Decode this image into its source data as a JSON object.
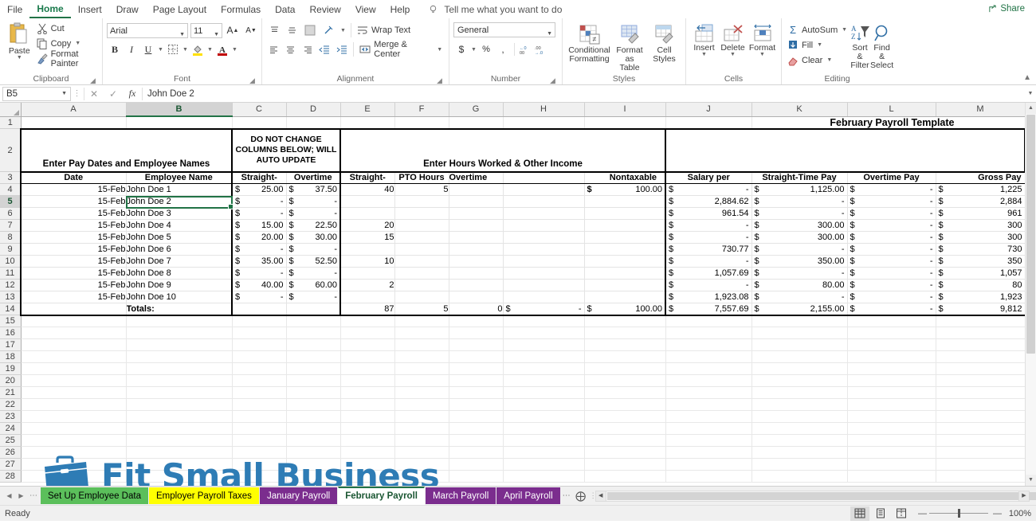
{
  "ribbon": {
    "tabs": [
      {
        "label": "File"
      },
      {
        "label": "Home"
      },
      {
        "label": "Insert"
      },
      {
        "label": "Draw"
      },
      {
        "label": "Page Layout"
      },
      {
        "label": "Formulas"
      },
      {
        "label": "Data"
      },
      {
        "label": "Review"
      },
      {
        "label": "View"
      },
      {
        "label": "Help"
      }
    ],
    "active_tab": "Home",
    "tellme": "Tell me what you want to do",
    "share": "Share",
    "groups": {
      "clipboard": {
        "label": "Clipboard",
        "paste": "Paste",
        "cut": "Cut",
        "copy": "Copy",
        "format_painter": "Format Painter"
      },
      "font": {
        "label": "Font",
        "font_name": "Arial",
        "font_size": "11",
        "bold": "B",
        "italic": "I",
        "underline": "U",
        "grow": "A",
        "shrink": "A"
      },
      "alignment": {
        "label": "Alignment",
        "wrap_text": "Wrap Text",
        "merge_center": "Merge & Center"
      },
      "number": {
        "label": "Number",
        "format": "General",
        "currency": "$",
        "percent": "%",
        "comma": ","
      },
      "styles": {
        "label": "Styles",
        "conditional_formatting": "Conditional\nFormatting",
        "cf_l1": "Conditional",
        "cf_l2": "Formatting",
        "fat_l1": "Format as",
        "fat_l2": "Table",
        "cs_l1": "Cell",
        "cs_l2": "Styles"
      },
      "cells": {
        "label": "Cells",
        "insert": "Insert",
        "delete": "Delete",
        "format": "Format"
      },
      "editing": {
        "label": "Editing",
        "autosum": "AutoSum",
        "fill": "Fill",
        "clear": "Clear",
        "sort_l1": "Sort &",
        "sort_l2": "Filter",
        "find_l1": "Find &",
        "find_l2": "Select"
      }
    }
  },
  "formula_bar": {
    "name_box": "B5",
    "cancel_icon": "✕",
    "enter_icon": "✓",
    "fx_icon": "fx",
    "value": "John Doe 2"
  },
  "sheet": {
    "columns": [
      "A",
      "B",
      "C",
      "D",
      "E",
      "F",
      "G",
      "H",
      "I",
      "J",
      "K",
      "L",
      "M"
    ],
    "selected_column": "B",
    "selected_row": "5",
    "rows": [
      "1",
      "2",
      "3",
      "4",
      "5",
      "6",
      "7",
      "8",
      "9",
      "10",
      "11",
      "12",
      "13",
      "14",
      "15",
      "16",
      "17",
      "18",
      "19",
      "20",
      "21",
      "22",
      "23",
      "24",
      "25",
      "26",
      "27",
      "28"
    ],
    "title": "February Payroll Template",
    "banners": {
      "pay_dates": "Enter Pay Dates and Employee Names",
      "do_not_change": [
        "DO NOT CHANGE",
        "COLUMNS BELOW; WILL",
        "AUTO UPDATE"
      ],
      "hours_worked": "Enter Hours Worked & Other Income"
    },
    "headers": {
      "date": "Date",
      "employee_name": "Employee Name",
      "straight_rate": "Straight-",
      "overtime_rate": "Overtime",
      "straight_hours": "Straight-",
      "pto_hours": "PTO Hours",
      "overtime_hours": "Overtime",
      "blank_h": "",
      "nontaxable": "Nontaxable",
      "salary_per": "Salary per",
      "straight_time_pay": "Straight-Time Pay",
      "overtime_pay": "Overtime Pay",
      "gross_pay": "Gross Pay"
    },
    "totals_label": "Totals:",
    "data_rows": [
      {
        "row": "4",
        "date": "15-Feb",
        "name": "John Doe 1",
        "rate": "25.00",
        "ot_rate": "37.50",
        "st_hours": "40",
        "pto": "5",
        "ot_hours": "",
        "blank": "",
        "nontax": "100.00",
        "salary": "-",
        "st_pay": "1,125.00",
        "ot_pay": "-",
        "gross": "1,225"
      },
      {
        "row": "5",
        "date": "15-Feb",
        "name": "John Doe 2",
        "rate": "-",
        "ot_rate": "-",
        "st_hours": "",
        "pto": "",
        "ot_hours": "",
        "blank": "",
        "nontax": "",
        "salary": "2,884.62",
        "st_pay": "-",
        "ot_pay": "-",
        "gross": "2,884"
      },
      {
        "row": "6",
        "date": "15-Feb",
        "name": "John Doe 3",
        "rate": "-",
        "ot_rate": "-",
        "st_hours": "",
        "pto": "",
        "ot_hours": "",
        "blank": "",
        "nontax": "",
        "salary": "961.54",
        "st_pay": "-",
        "ot_pay": "-",
        "gross": "961"
      },
      {
        "row": "7",
        "date": "15-Feb",
        "name": "John Doe 4",
        "rate": "15.00",
        "ot_rate": "22.50",
        "st_hours": "20",
        "pto": "",
        "ot_hours": "",
        "blank": "",
        "nontax": "",
        "salary": "-",
        "st_pay": "300.00",
        "ot_pay": "-",
        "gross": "300"
      },
      {
        "row": "8",
        "date": "15-Feb",
        "name": "John Doe 5",
        "rate": "20.00",
        "ot_rate": "30.00",
        "st_hours": "15",
        "pto": "",
        "ot_hours": "",
        "blank": "",
        "nontax": "",
        "salary": "-",
        "st_pay": "300.00",
        "ot_pay": "-",
        "gross": "300"
      },
      {
        "row": "9",
        "date": "15-Feb",
        "name": "John Doe 6",
        "rate": "-",
        "ot_rate": "-",
        "st_hours": "",
        "pto": "",
        "ot_hours": "",
        "blank": "",
        "nontax": "",
        "salary": "730.77",
        "st_pay": "-",
        "ot_pay": "-",
        "gross": "730"
      },
      {
        "row": "10",
        "date": "15-Feb",
        "name": "John Doe 7",
        "rate": "35.00",
        "ot_rate": "52.50",
        "st_hours": "10",
        "pto": "",
        "ot_hours": "",
        "blank": "",
        "nontax": "",
        "salary": "-",
        "st_pay": "350.00",
        "ot_pay": "-",
        "gross": "350"
      },
      {
        "row": "11",
        "date": "15-Feb",
        "name": "John Doe 8",
        "rate": "-",
        "ot_rate": "-",
        "st_hours": "",
        "pto": "",
        "ot_hours": "",
        "blank": "",
        "nontax": "",
        "salary": "1,057.69",
        "st_pay": "-",
        "ot_pay": "-",
        "gross": "1,057"
      },
      {
        "row": "12",
        "date": "15-Feb",
        "name": "John Doe 9",
        "rate": "40.00",
        "ot_rate": "60.00",
        "st_hours": "2",
        "pto": "",
        "ot_hours": "",
        "blank": "",
        "nontax": "",
        "salary": "-",
        "st_pay": "80.00",
        "ot_pay": "-",
        "gross": "80"
      },
      {
        "row": "13",
        "date": "15-Feb",
        "name": "John Doe 10",
        "rate": "-",
        "ot_rate": "-",
        "st_hours": "",
        "pto": "",
        "ot_hours": "",
        "blank": "",
        "nontax": "",
        "salary": "1,923.08",
        "st_pay": "-",
        "ot_pay": "-",
        "gross": "1,923"
      }
    ],
    "totals": {
      "st_hours": "87",
      "pto": "5",
      "ot_hours": "0",
      "blank": "-",
      "nontax": "100.00",
      "salary": "7,557.69",
      "st_pay": "2,155.00",
      "ot_pay": "-",
      "gross": "9,812"
    },
    "currency_symbol": "$",
    "logo_text": "Fit Small Business",
    "logo_color": "#2E7CB5"
  },
  "sheet_tabs": {
    "items": [
      {
        "label": "Set Up Employee Data",
        "color": "#5BBF5B",
        "text_color": "#000000",
        "active": false
      },
      {
        "label": "Employer Payroll Taxes",
        "color": "#FFFF00",
        "text_color": "#000000",
        "active": false
      },
      {
        "label": "January Payroll",
        "color": "#7B2D8E",
        "text_color": "#FFFFFF",
        "active": false
      },
      {
        "label": "February Payroll",
        "color": "#FFFFFF",
        "text_color": "#1a5632",
        "active": true
      },
      {
        "label": "March Payroll",
        "color": "#7B2D8E",
        "text_color": "#FFFFFF",
        "active": false
      },
      {
        "label": "April Payroll",
        "color": "#7B2D8E",
        "text_color": "#FFFFFF",
        "active": false
      }
    ],
    "add_sheet": "+"
  },
  "status_bar": {
    "status": "Ready",
    "zoom": "100%",
    "views": [
      "normal-view",
      "page-layout-view",
      "page-break-view"
    ]
  }
}
